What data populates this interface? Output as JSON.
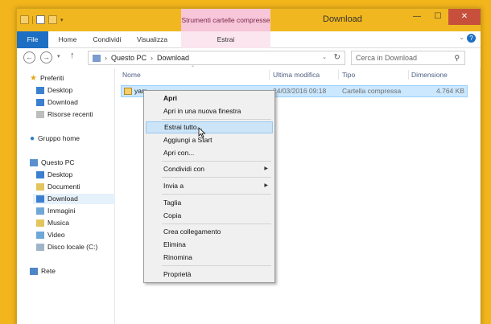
{
  "window": {
    "title": "Download",
    "context_tab_title": "Strumenti cartelle compresse"
  },
  "window_buttons": {
    "minimize": "—",
    "maximize": "☐",
    "close": "✕"
  },
  "ribbon": {
    "tabs": [
      "File",
      "Home",
      "Condividi",
      "Visualizza",
      "Estrai"
    ],
    "help": "?"
  },
  "address": {
    "crumbs": [
      "Questo PC",
      "Download"
    ],
    "search_placeholder": "Cerca in Download"
  },
  "sidebar": {
    "favorites_header": "Preferiti",
    "favorites": [
      "Desktop",
      "Download",
      "Risorse recenti"
    ],
    "homegroup": "Gruppo home",
    "pc_header": "Questo PC",
    "pc_items": [
      "Desktop",
      "Documenti",
      "Download",
      "Immagini",
      "Musica",
      "Video",
      "Disco locale (C:)"
    ],
    "network": "Rete",
    "selected": "Download"
  },
  "columns": [
    "Nome",
    "Ultima modifica",
    "Tipo",
    "Dimensione"
  ],
  "file": {
    "name": "yam",
    "modified": "24/03/2016 09:18",
    "type": "Cartella compressa",
    "size": "4.764 KB"
  },
  "context_menu": {
    "items": [
      {
        "label": "Apri",
        "bold": true
      },
      {
        "label": "Apri in una nuova finestra"
      },
      {
        "label": "Estrai tutto...",
        "hover": true
      },
      {
        "label": "Aggiungi a Start"
      },
      {
        "label": "Apri con..."
      },
      {
        "label": "Condividi con",
        "submenu": true
      },
      {
        "label": "Invia a",
        "submenu": true
      },
      {
        "label": "Taglia"
      },
      {
        "label": "Copia"
      },
      {
        "label": "Crea collegamento"
      },
      {
        "label": "Elimina"
      },
      {
        "label": "Rinomina"
      },
      {
        "label": "Proprietà"
      }
    ]
  },
  "colors": {
    "accent": "#1e6fc3",
    "titlebar": "#f1b720",
    "selection": "#cce8ff",
    "context_tab": "#f7c6d8"
  }
}
